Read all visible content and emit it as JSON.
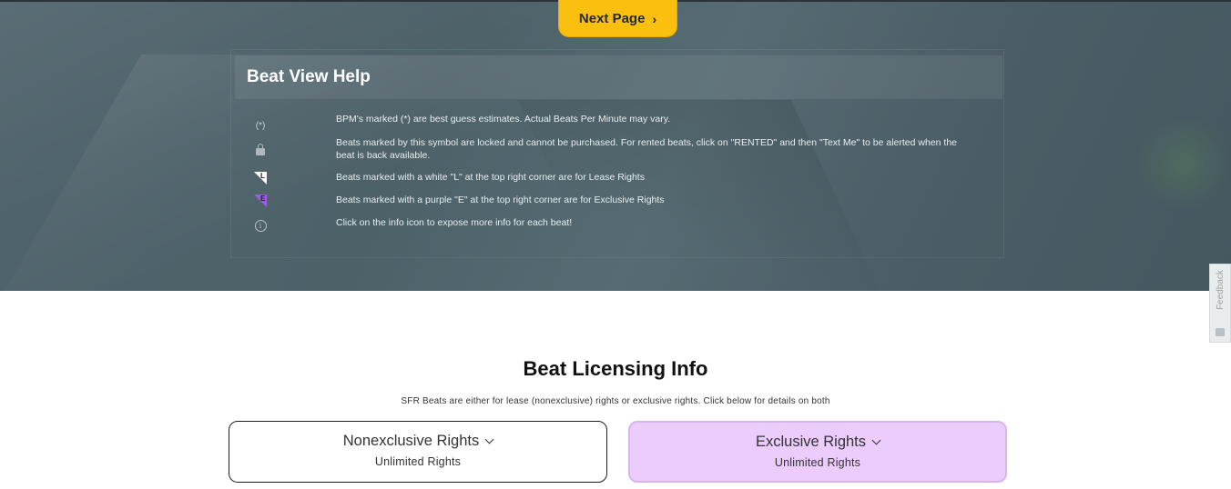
{
  "pager": {
    "next_label": "Next Page",
    "next_icon": "chevron-right-icon"
  },
  "help": {
    "title": "Beat View Help",
    "items": [
      {
        "icon": "asterisk-marker",
        "icon_text": "(*)",
        "text": "BPM's marked (*) are best guess estimates. Actual Beats Per Minute may vary."
      },
      {
        "icon": "lock-icon",
        "icon_text": "",
        "text": "Beats marked by this symbol are locked and cannot be purchased. For rented beats, click on \"RENTED\" and then \"Text Me\" to be alerted when the beat is back available."
      },
      {
        "icon": "lease-badge-icon",
        "icon_text": "L",
        "text": "Beats marked with a white \"L\" at the top right corner are for Lease Rights"
      },
      {
        "icon": "exclusive-badge-icon",
        "icon_text": "E",
        "text": "Beats marked with a purple \"E\" at the top right corner are for Exclusive Rights"
      },
      {
        "icon": "info-icon",
        "icon_text": "i",
        "text": "Click on the info icon to expose more info for each beat!"
      }
    ]
  },
  "feedback": {
    "label": "Feedback"
  },
  "licensing": {
    "title": "Beat Licensing Info",
    "subtitle": "SFR Beats are either for lease (nonexclusive) rights or exclusive rights. Click below for details on both",
    "options": [
      {
        "title": "Nonexclusive Rights",
        "subtitle": "Unlimited Rights"
      },
      {
        "title": "Exclusive Rights",
        "subtitle": "Unlimited Rights"
      }
    ]
  },
  "colors": {
    "accent_yellow": "#fbbf0f",
    "exclusive_purple": "#eccbfd",
    "hero_bg": "#4f636b"
  }
}
